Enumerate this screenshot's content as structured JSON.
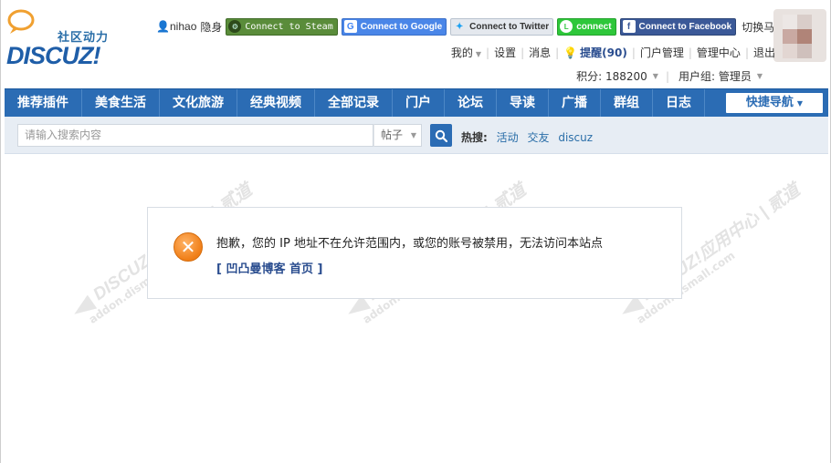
{
  "site": {
    "logo_cn": "社区动力",
    "logo_en": "DISCUZ!"
  },
  "userbar": {
    "username": "nihao",
    "invisible_label": "隐身",
    "connect_steam": "Connect to Steam",
    "connect_google": "Connect to Google",
    "connect_twitter": "Connect to Twitter",
    "connect_line": "connect",
    "connect_facebook": "Connect to Facebook",
    "switch_account": "切换马甲"
  },
  "topmenu": {
    "mine": "我的",
    "settings": "设置",
    "messages": "消息",
    "remind": "提醒(90)",
    "portal_manage": "门户管理",
    "admin_center": "管理中心",
    "logout": "退出"
  },
  "credits": {
    "points": "积分: 188200",
    "usergroup": "用户组: 管理员"
  },
  "nav": {
    "items": [
      "推荐插件",
      "美食生活",
      "文化旅游",
      "经典视频",
      "全部记录",
      "门户",
      "论坛",
      "导读",
      "广播",
      "群组",
      "日志"
    ],
    "quick_nav": "快捷导航"
  },
  "search": {
    "placeholder": "请输入搜索内容",
    "type_selected": "帖子",
    "hot_label": "热搜:",
    "hot_keywords": [
      "活动",
      "交友",
      "discuz"
    ]
  },
  "message": {
    "text": "抱歉，您的 IP 地址不在允许范围内，或您的账号被禁用，无法访问本站点",
    "link": "[ 凹凸曼博客 首页 ]"
  },
  "watermark": {
    "big": "DISCUZ!应用中心 | 贰道",
    "small": "addon.dismall.com"
  },
  "colors": {
    "nav_blue": "#2b6cb4",
    "link_blue": "#2a4d8f",
    "error_orange": "#f07e17"
  }
}
